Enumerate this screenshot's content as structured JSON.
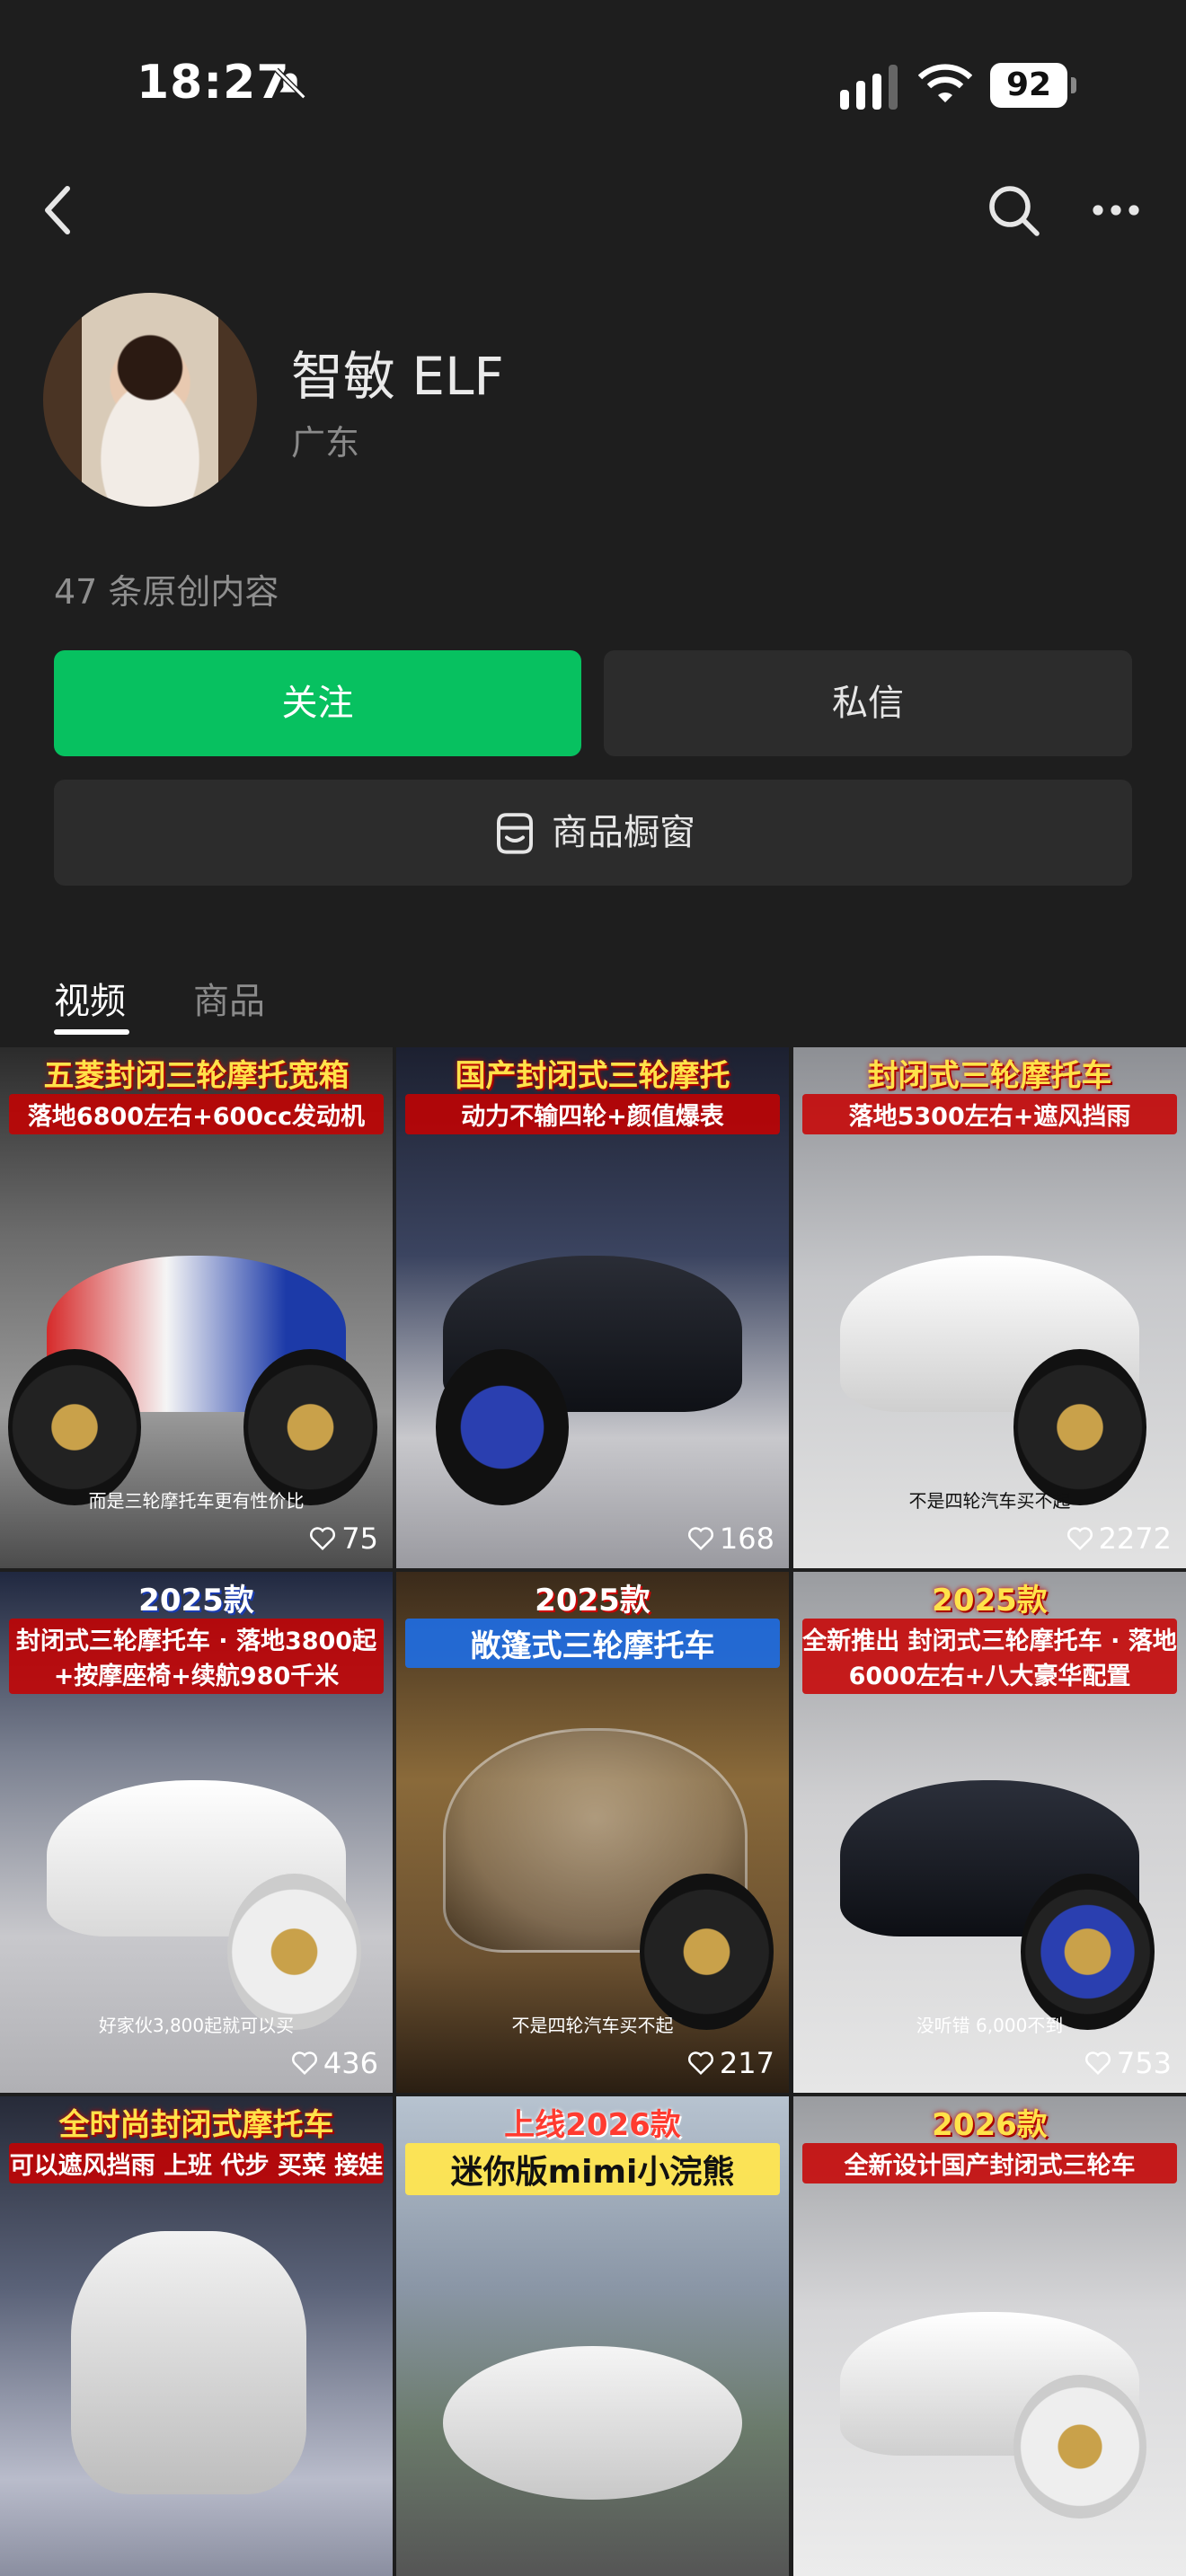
{
  "status": {
    "time": "18:27",
    "battery": "92"
  },
  "profile": {
    "name": "智敏 ELF",
    "region": "广东",
    "content_count": "47 条原创内容"
  },
  "buttons": {
    "follow": "关注",
    "message": "私信",
    "shop": "商品橱窗"
  },
  "tabs": [
    {
      "label": "视频",
      "active": true
    },
    {
      "label": "商品",
      "active": false
    }
  ],
  "videos": [
    {
      "headline": "五菱封闭三轮摩托宽箱",
      "headline2": "落地6800左右+600cc发动机",
      "caption": "而是三轮摩托车更有性价比",
      "likes": "75"
    },
    {
      "headline": "国产封闭式三轮摩托",
      "headline2": "动力不输四轮+颜值爆表",
      "caption": "",
      "likes": "168"
    },
    {
      "headline": "封闭式三轮摩托车",
      "headline2": "落地5300左右+遮风挡雨",
      "caption": "不是四轮汽车买不起",
      "likes": "2272"
    },
    {
      "headline": "2025款",
      "headline2": "封闭式三轮摩托车 · 落地3800起+按摩座椅+续航980千米",
      "caption": "好家伙3,800起就可以买",
      "likes": "436"
    },
    {
      "headline": "2025款",
      "headline2": "敞篷式三轮摩托车",
      "caption": "不是四轮汽车买不起",
      "likes": "217"
    },
    {
      "headline": "2025款",
      "headline2": "全新推出 封闭式三轮摩托车 · 落地6000左右+八大豪华配置",
      "caption": "没听错 6,000不到",
      "likes": "753"
    },
    {
      "headline": "全时尚封闭式摩托车",
      "headline2": "可以遮风挡雨 上班 代步 买菜 接娃",
      "caption": "",
      "likes": ""
    },
    {
      "headline": "上线2026款",
      "headline2": "迷你版mimi小浣熊",
      "caption": "",
      "likes": ""
    },
    {
      "headline": "2026款",
      "headline2": "全新设计国产封闭式三轮车",
      "caption": "",
      "likes": ""
    }
  ],
  "colors": {
    "accent": "#07c160",
    "background": "#1e1e1e",
    "button_dark": "#2c2c2c"
  }
}
